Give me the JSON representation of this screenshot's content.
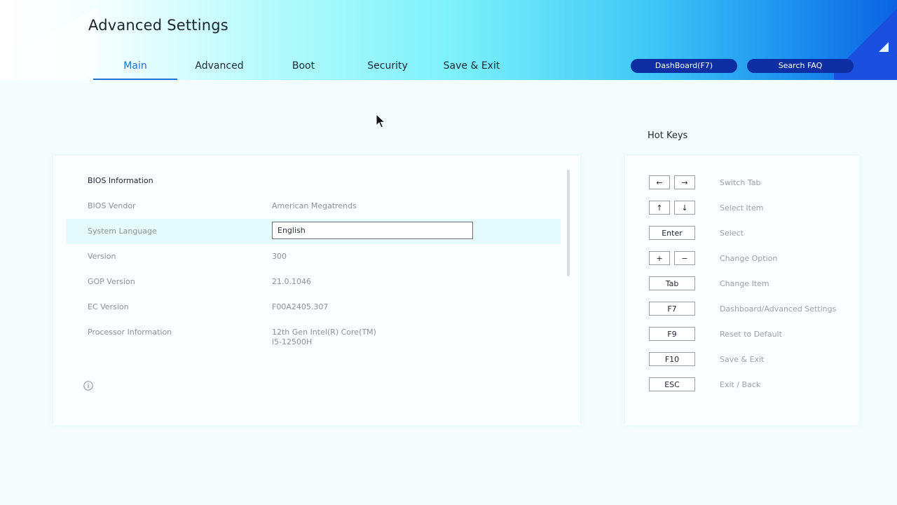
{
  "header": {
    "title": "Advanced Settings",
    "tabs": [
      {
        "label": "Main"
      },
      {
        "label": "Advanced"
      },
      {
        "label": "Boot"
      },
      {
        "label": "Security"
      },
      {
        "label": "Save & Exit"
      }
    ],
    "dashboard_button": "DashBoard(F7)",
    "faq_button": "Search FAQ"
  },
  "main": {
    "section_title": "BIOS Information",
    "rows": [
      {
        "label": "BIOS Vendor",
        "value": "American Megatrends"
      },
      {
        "label": "System Language",
        "value": "English"
      },
      {
        "label": "Version",
        "value": "300"
      },
      {
        "label": "GOP Version",
        "value": "21.0.1046"
      },
      {
        "label": "EC Version",
        "value": "F00A2405.307"
      },
      {
        "label": "Processor Information",
        "value_line1": "12th Gen Intel(R) Core(TM)",
        "value_line2": "i5-12500H"
      }
    ]
  },
  "hotkeys": {
    "title": "Hot Keys",
    "items": [
      {
        "keys": [
          "←",
          "→"
        ],
        "desc": "Switch Tab"
      },
      {
        "keys": [
          "↑",
          "↓"
        ],
        "desc": "Select Item"
      },
      {
        "keys": [
          "Enter"
        ],
        "desc": "Select"
      },
      {
        "keys": [
          "+",
          "−"
        ],
        "desc": "Change Option"
      },
      {
        "keys": [
          "Tab"
        ],
        "desc": "Change Item"
      },
      {
        "keys": [
          "F7"
        ],
        "desc": "Dashboard/Advanced Settings"
      },
      {
        "keys": [
          "F9"
        ],
        "desc": "Reset to Default"
      },
      {
        "keys": [
          "F10"
        ],
        "desc": "Save & Exit"
      },
      {
        "keys": [
          "ESC"
        ],
        "desc": "Exit / Back"
      }
    ]
  },
  "colors": {
    "accent": "#1e6fd0",
    "pill": "#0d2fa3",
    "highlight_row": "#e6fbfb"
  },
  "icons": [
    "info-icon",
    "mouse-pointer-icon"
  ]
}
